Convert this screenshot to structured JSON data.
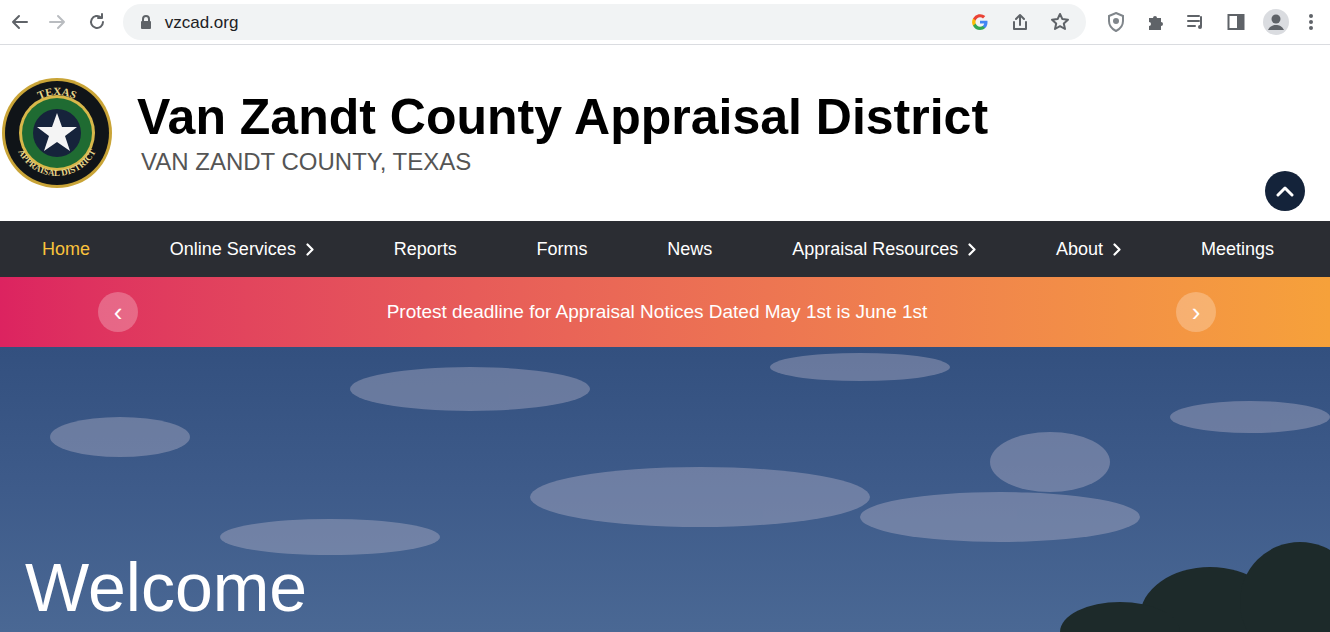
{
  "browser": {
    "url": "vzcad.org"
  },
  "header": {
    "logo": {
      "top": "TEXAS",
      "bottom": "APPRAISAL DISTRICT"
    },
    "title": "Van Zandt County Appraisal District",
    "subtitle": "VAN ZANDT COUNTY, TEXAS"
  },
  "nav": [
    {
      "label": "Home",
      "selected": true,
      "submenu": false
    },
    {
      "label": "Online Services",
      "selected": false,
      "submenu": true
    },
    {
      "label": "Reports",
      "selected": false,
      "submenu": false
    },
    {
      "label": "Forms",
      "selected": false,
      "submenu": false
    },
    {
      "label": "News",
      "selected": false,
      "submenu": false
    },
    {
      "label": "Appraisal Resources",
      "selected": false,
      "submenu": true
    },
    {
      "label": "About",
      "selected": false,
      "submenu": true
    },
    {
      "label": "Meetings",
      "selected": false,
      "submenu": false
    }
  ],
  "banner": {
    "prev": "‹",
    "text": "Protest deadline for Appraisal Notices Dated May 1st is June 1st",
    "next": "›"
  },
  "hero": {
    "heading": "Welcome"
  }
}
